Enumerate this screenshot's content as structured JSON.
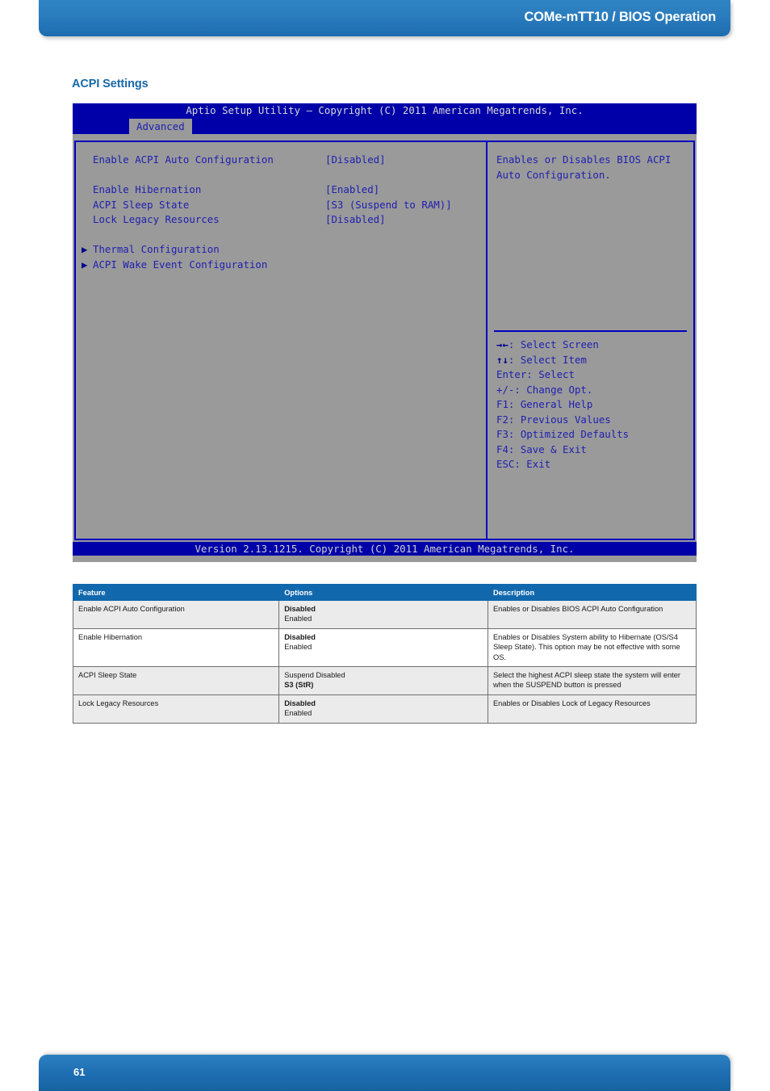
{
  "header": {
    "title": "COMe-mTT10 / BIOS Operation"
  },
  "section": {
    "heading": "ACPI Settings"
  },
  "bios": {
    "titlebar": "Aptio Setup Utility – Copyright (C) 2011 American Megatrends, Inc.",
    "tab": "Advanced",
    "footer": "Version 2.13.1215. Copyright (C) 2011 American Megatrends, Inc.",
    "options": [
      {
        "name": "Enable ACPI Auto Configuration",
        "value": "[Disabled]"
      },
      {
        "name": "Enable Hibernation",
        "value": "[Enabled]"
      },
      {
        "name": "ACPI Sleep State",
        "value": "[S3 (Suspend to RAM)]"
      },
      {
        "name": "Lock Legacy Resources",
        "value": "[Disabled]"
      }
    ],
    "submenus": [
      {
        "arrow": "▶",
        "label": "Thermal Configuration"
      },
      {
        "arrow": "▶",
        "label": "ACPI Wake Event Configuration"
      }
    ],
    "help": "Enables or Disables BIOS ACPI\nAuto Configuration.",
    "keys": [
      {
        "glyph": "→←",
        "text": ": Select Screen"
      },
      {
        "glyph": "↑↓",
        "text": ": Select Item"
      },
      {
        "glyph": "",
        "text": "Enter: Select"
      },
      {
        "glyph": "",
        "text": "+/-: Change Opt."
      },
      {
        "glyph": "",
        "text": "F1: General Help"
      },
      {
        "glyph": "",
        "text": "F2: Previous Values"
      },
      {
        "glyph": "",
        "text": "F3: Optimized Defaults"
      },
      {
        "glyph": "",
        "text": "F4: Save & Exit"
      },
      {
        "glyph": "",
        "text": "ESC: Exit"
      }
    ]
  },
  "table": {
    "headers": [
      "Feature",
      "Options",
      "Description"
    ],
    "rows": [
      {
        "feature": "Enable ACPI Auto Configuration",
        "options": [
          {
            "text": "Disabled",
            "bold": true
          },
          {
            "text": "Enabled",
            "bold": false
          }
        ],
        "description": "Enables or Disables BIOS ACPI Auto Configuration"
      },
      {
        "feature": "Enable Hibernation",
        "options": [
          {
            "text": "Disabled",
            "bold": true
          },
          {
            "text": "Enabled",
            "bold": false
          }
        ],
        "description": "Enables or Disables System ability to Hibernate (OS/S4 Sleep State). This option may be not effective with some OS."
      },
      {
        "feature": "ACPI Sleep State",
        "options": [
          {
            "text": "Suspend Disabled",
            "bold": false
          },
          {
            "text": "S3 (StR)",
            "bold": true
          }
        ],
        "description": "Select the highest ACPI sleep state the system will enter when the SUSPEND button is pressed"
      },
      {
        "feature": "Lock Legacy Resources",
        "options": [
          {
            "text": "Disabled",
            "bold": true
          },
          {
            "text": "Enabled",
            "bold": false
          }
        ],
        "description": "Enables or Disables Lock of Legacy Resources"
      }
    ]
  },
  "footer": {
    "page_number": "61"
  }
}
